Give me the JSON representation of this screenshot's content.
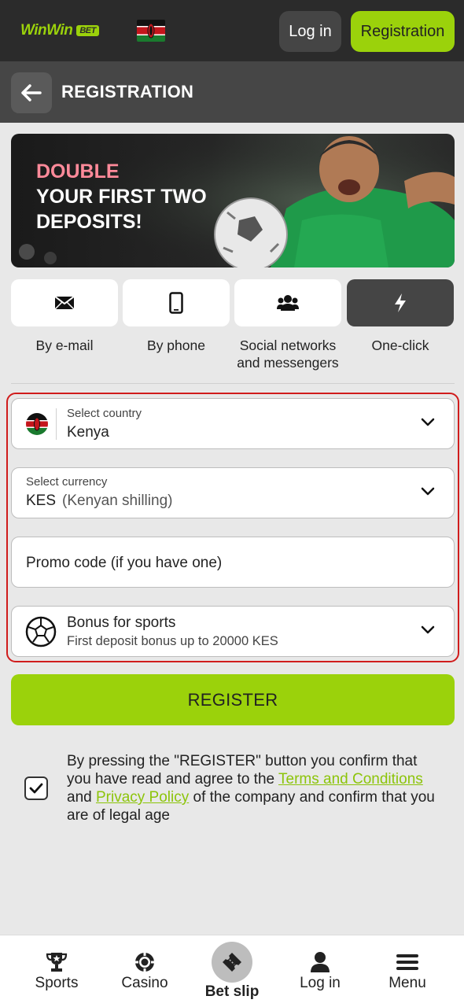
{
  "header": {
    "logo_main": "WinWin",
    "logo_badge": "BET",
    "login_label": "Log in",
    "registration_label": "Registration"
  },
  "page": {
    "title": "REGISTRATION"
  },
  "banner": {
    "line1": "DOUBLE",
    "line2": "YOUR FIRST TWO",
    "line3": "DEPOSITS!"
  },
  "tabs": [
    {
      "label": "By e-mail",
      "icon": "envelope-icon"
    },
    {
      "label": "By phone",
      "icon": "phone-icon"
    },
    {
      "label": "Social networks and messengers",
      "icon": "people-icon"
    },
    {
      "label": "One-click",
      "icon": "lightning-icon",
      "active": true
    }
  ],
  "form": {
    "country": {
      "label": "Select country",
      "value": "Kenya"
    },
    "currency": {
      "label": "Select currency",
      "code": "KES",
      "name": "(Kenyan shilling)"
    },
    "promo": {
      "placeholder": "Promo code (if you have one)"
    },
    "bonus": {
      "title": "Bonus for sports",
      "subtitle": "First deposit bonus up to 20000 KES"
    }
  },
  "register_label": "REGISTER",
  "consent": {
    "checked": true,
    "text_before": "By pressing the \"REGISTER\" button you confirm that you have read and agree to the ",
    "terms_link": "Terms and Conditions",
    "text_and": " and ",
    "privacy_link": "Privacy Policy",
    "text_after": " of the company and confirm that you are of legal age"
  },
  "bottom_nav": {
    "sports": "Sports",
    "casino": "Casino",
    "betslip": "Bet slip",
    "login": "Log in",
    "menu": "Menu"
  },
  "colors": {
    "accent": "#9bd20b",
    "header_bg": "#2b2b2b",
    "titlebar_bg": "#464646",
    "outline": "#d01c1c"
  }
}
